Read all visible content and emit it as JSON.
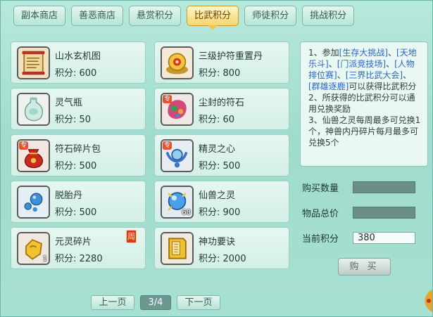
{
  "tabs": [
    {
      "label": "副本商店",
      "active": false
    },
    {
      "label": "善恶商店",
      "active": false
    },
    {
      "label": "悬赏积分",
      "active": false
    },
    {
      "label": "比武积分",
      "active": true
    },
    {
      "label": "师徒积分",
      "active": false
    },
    {
      "label": "挑战积分",
      "active": false
    }
  ],
  "items": [
    {
      "name": "山水玄机图",
      "price": "积分: 600",
      "icon": "scroll-icon"
    },
    {
      "name": "三级护符重置丹",
      "price": "积分: 800",
      "icon": "golden-pill-icon"
    },
    {
      "name": "灵气瓶",
      "price": "积分: 50",
      "icon": "vase-icon"
    },
    {
      "name": "尘封的符石",
      "price": "积分: 60",
      "icon": "rune-stone-icon",
      "tag": "专"
    },
    {
      "name": "符石碎片包",
      "price": "积分: 500",
      "icon": "red-bag-icon",
      "tag": "专"
    },
    {
      "name": "精灵之心",
      "price": "积分: 500",
      "icon": "spirit-heart-icon",
      "tag": "专"
    },
    {
      "name": "脱胎丹",
      "price": "积分: 500",
      "icon": "blue-pills-icon"
    },
    {
      "name": "仙兽之灵",
      "price": "积分: 900",
      "icon": "beast-orb-icon",
      "count": "68"
    },
    {
      "name": "元灵碎片",
      "price": "积分: 2280",
      "icon": "gold-fragment-icon",
      "count": "1",
      "badge": "周"
    },
    {
      "name": "神功要诀",
      "price": "积分: 2000",
      "icon": "yellow-book-icon"
    }
  ],
  "info": {
    "line1_a": "1、参加",
    "line1_b": "[生存大挑战]",
    "line1_c": "、",
    "line1_d": "[天地乐斗]",
    "line1_e": "、",
    "line1_f": "[门派竞技场]",
    "line1_g": "、",
    "line1_h": "[人物排位赛]",
    "line1_i": "、",
    "line1_j": "[三界比武大会]",
    "line1_k": "、",
    "line1_l": "[群雄逐鹿]",
    "line1_m": "可以获得比武积分",
    "line2": "2、所获得的比武积分可以通用兑换奖励",
    "line3": "3、仙兽之灵每周最多可兑换1个，神兽内丹碎片每月最多可兑换5个"
  },
  "fields": {
    "quantity_label": "购买数量",
    "total_label": "物品总价",
    "current_label": "当前积分",
    "current_value": "380"
  },
  "buy_label": "购 买",
  "pager": {
    "prev": "上一页",
    "page": "3/4",
    "next": "下一页"
  }
}
